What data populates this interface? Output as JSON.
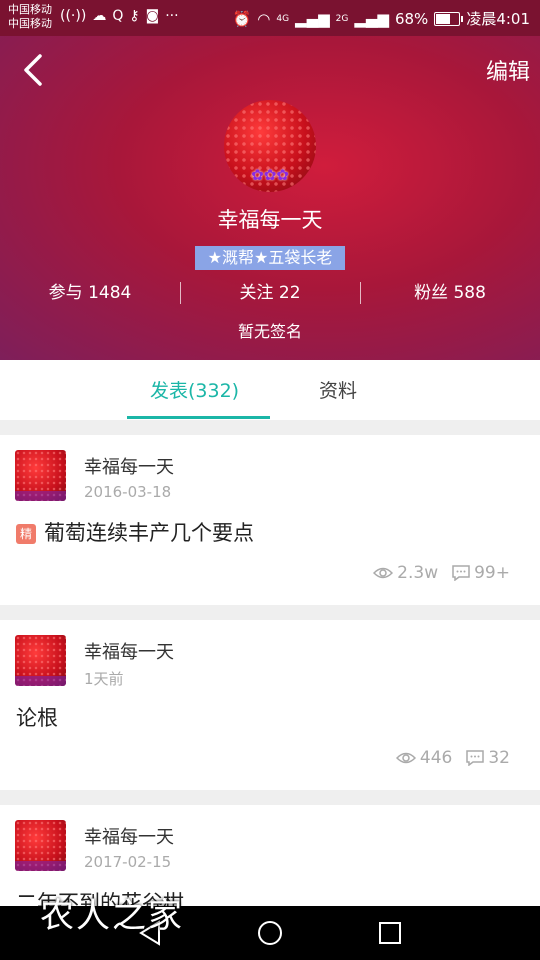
{
  "status_bar": {
    "carrier_1": "中国移动",
    "carrier_2": "中国移动",
    "network_1": "4G",
    "network_2": "2G",
    "battery_percent": "68%",
    "time": "凌晨4:01"
  },
  "header": {
    "edit_label": "编辑",
    "username": "幸福每一天",
    "badge": "★溉帮★五袋长老",
    "stats": [
      {
        "label": "参与",
        "value": "1484"
      },
      {
        "label": "关注",
        "value": "22"
      },
      {
        "label": "粉丝",
        "value": "588"
      }
    ],
    "signature": "暂无签名"
  },
  "tabs": [
    {
      "label": "发表(332)",
      "active": true
    },
    {
      "label": "资料",
      "active": false
    }
  ],
  "posts": [
    {
      "user": "幸福每一天",
      "date": "2016-03-18",
      "featured_label": "精",
      "title": "葡萄连续丰产几个要点",
      "views": "2.3w",
      "comments": "99+"
    },
    {
      "user": "幸福每一天",
      "date": "1天前",
      "title": "论根",
      "views": "446",
      "comments": "32"
    },
    {
      "user": "幸福每一天",
      "date": "2017-02-15",
      "title": "二年不到的花谷柑"
    }
  ],
  "watermark": "农人之家",
  "colors": {
    "accent": "#1bb6a7",
    "header": "#a8173a",
    "badge": "#8aa4e6",
    "featured": "#f07b6a"
  }
}
